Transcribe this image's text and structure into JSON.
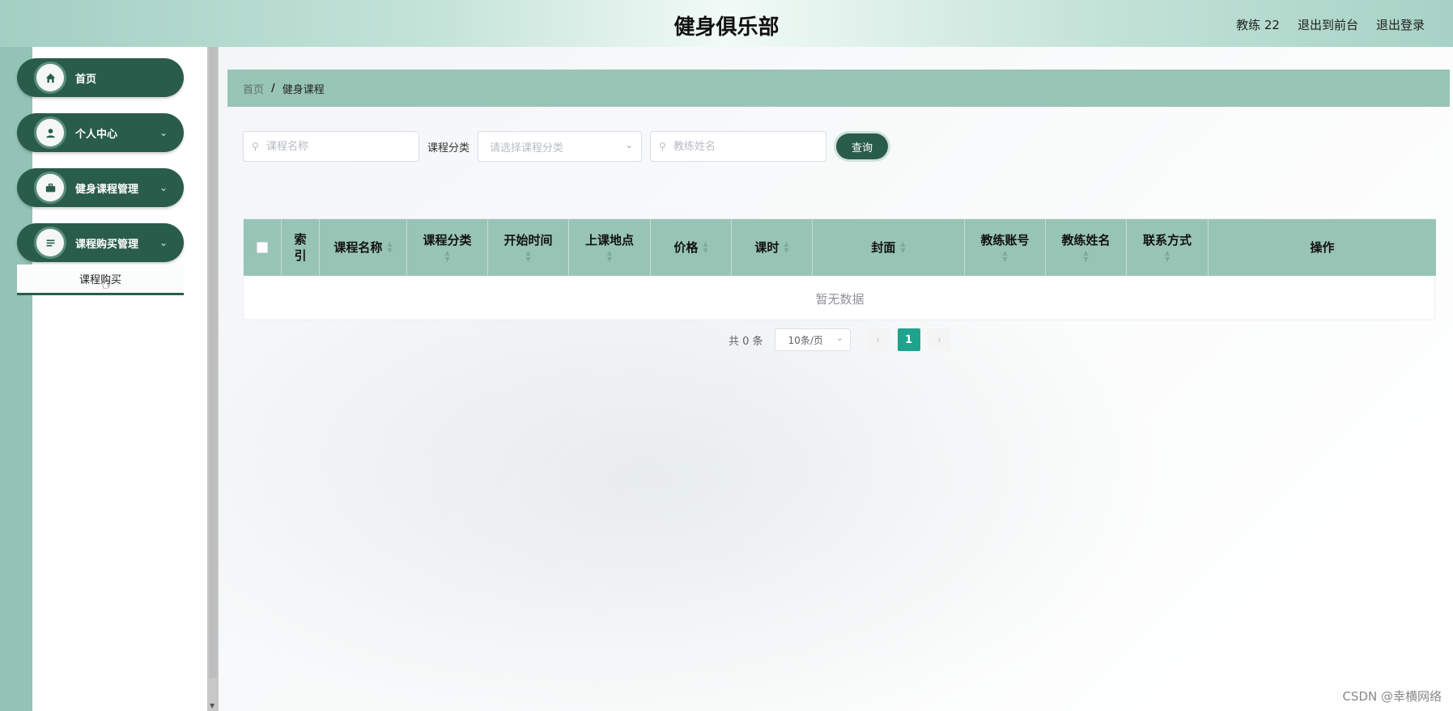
{
  "header": {
    "title": "健身俱乐部",
    "user": "教练 22",
    "to_front": "退出到前台",
    "logout": "退出登录"
  },
  "sidebar": {
    "items": [
      {
        "label": "首页",
        "icon": "home-icon"
      },
      {
        "label": "个人中心",
        "icon": "user-icon"
      },
      {
        "label": "健身课程管理",
        "icon": "briefcase-icon"
      },
      {
        "label": "课程购买管理",
        "icon": "list-icon"
      }
    ],
    "submenu_item": "课程购买"
  },
  "breadcrumb": {
    "home": "首页",
    "separator": "/",
    "current": "健身课程"
  },
  "search": {
    "course_name_placeholder": "课程名称",
    "category_label": "课程分类",
    "category_placeholder": "请选择课程分类",
    "coach_name_placeholder": "教练姓名",
    "query_button": "查询"
  },
  "table": {
    "columns": [
      "索引",
      "课程名称",
      "课程分类",
      "开始时间",
      "上课地点",
      "价格",
      "课时",
      "封面",
      "教练账号",
      "教练姓名",
      "联系方式",
      "操作"
    ],
    "empty_text": "暂无数据"
  },
  "pagination": {
    "total": "共 0 条",
    "page_size": "10条/页",
    "current_page": "1"
  },
  "watermark": "CSDN @幸横网络",
  "colors": {
    "primary": "#2a5c4b",
    "header_teal": "#98c4b6",
    "active_page": "#1fa38c"
  }
}
